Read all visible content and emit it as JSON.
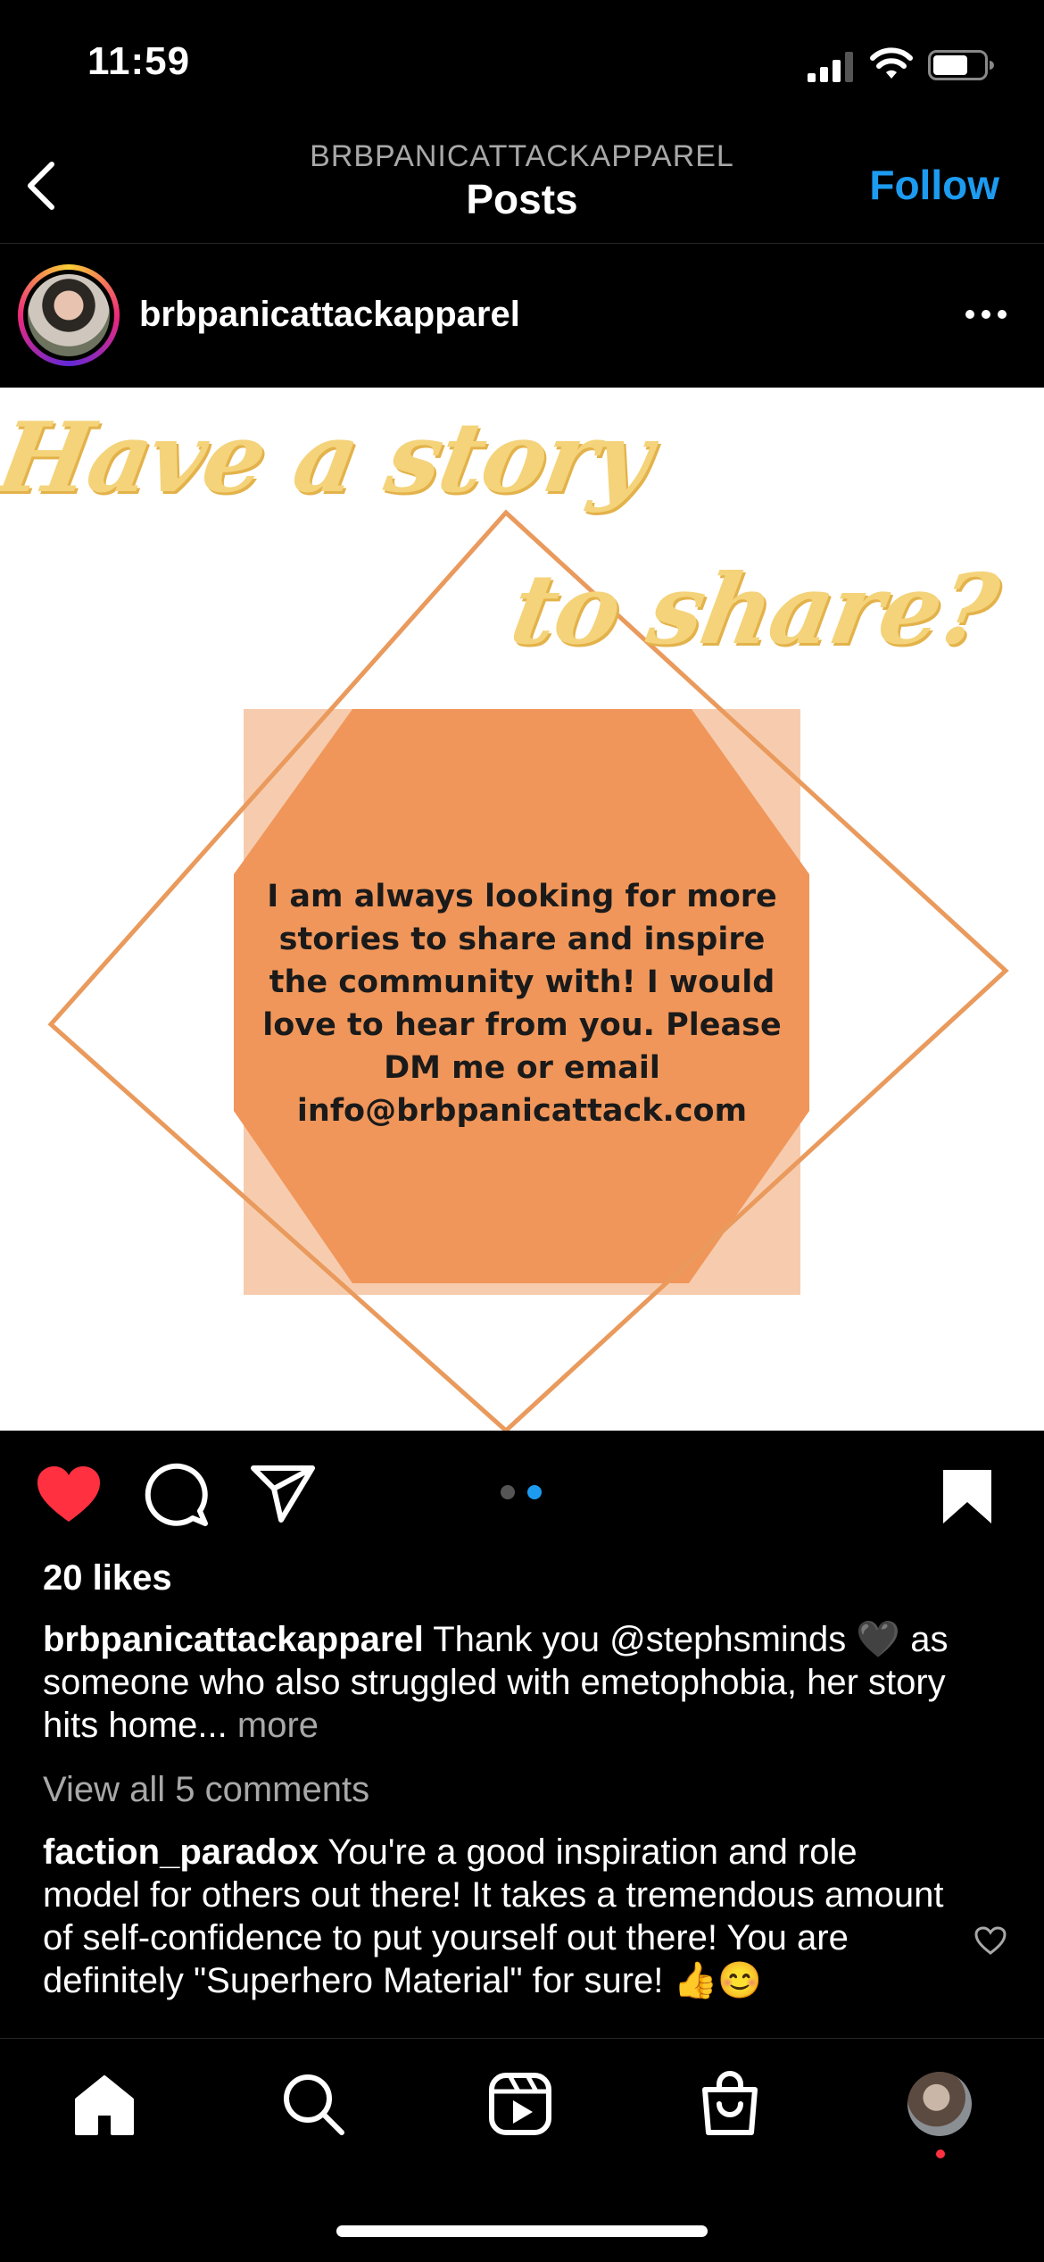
{
  "status_bar": {
    "time": "11:59"
  },
  "header": {
    "account": "BRBPANICATTACKAPPAREL",
    "title": "Posts",
    "follow_label": "Follow"
  },
  "post": {
    "username": "brbpanicattackapparel",
    "image": {
      "headline_1": "Have a story",
      "headline_2": "to share?",
      "body": "I am always looking for more stories to share and inspire the community with! I would love to hear from you. Please DM me or email info@brbpanicattack.com"
    },
    "likes": "20 likes",
    "caption": {
      "user": "brbpanicattackapparel",
      "text": " Thank you @stephsminds 🖤 as someone who also struggled with emetophobia, her story hits home...",
      "more": " more"
    },
    "view_all": "View all 5 comments",
    "comment": {
      "user": "faction_paradox",
      "text": " You're a good inspiration and role model for others out there! It takes a tremendous amount of self-confidence to put yourself out there! You are definitely \"Superhero Material\" for sure! 👍😊"
    }
  },
  "colors": {
    "accent": "#1d9bf0",
    "liked": "#ff3040",
    "orange": "#f0965a",
    "light_orange": "#f7ccae"
  },
  "icons": [
    "back-icon",
    "more-icon",
    "heart-icon",
    "comment-icon",
    "share-icon",
    "bookmark-icon",
    "home-icon",
    "search-icon",
    "reels-icon",
    "shop-icon"
  ]
}
